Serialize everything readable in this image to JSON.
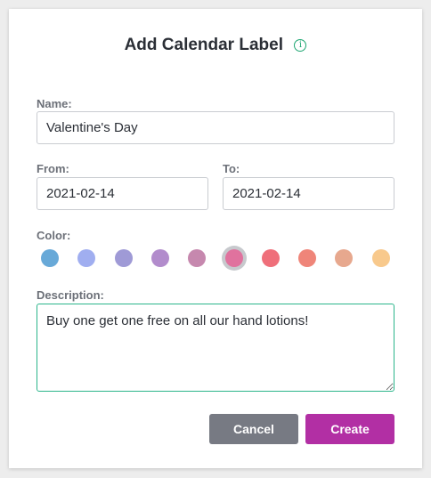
{
  "dialog": {
    "title": "Add Calendar Label",
    "info_icon": "info-circle-icon"
  },
  "form": {
    "name_label": "Name:",
    "name_value": "Valentine's Day",
    "from_label": "From:",
    "from_value": "2021-02-14",
    "to_label": "To:",
    "to_value": "2021-02-14",
    "color_label": "Color:",
    "colors": [
      "#68a9d8",
      "#a0aef0",
      "#9f9ad6",
      "#b28ccc",
      "#c688ae",
      "#e0729e",
      "#ef6f7a",
      "#ef8579",
      "#e7a88e",
      "#f8c98c"
    ],
    "selected_color_index": 5,
    "description_label": "Description:",
    "description_value": "Buy one get one free on all our hand lotions!"
  },
  "buttons": {
    "cancel_label": "Cancel",
    "create_label": "Create"
  }
}
